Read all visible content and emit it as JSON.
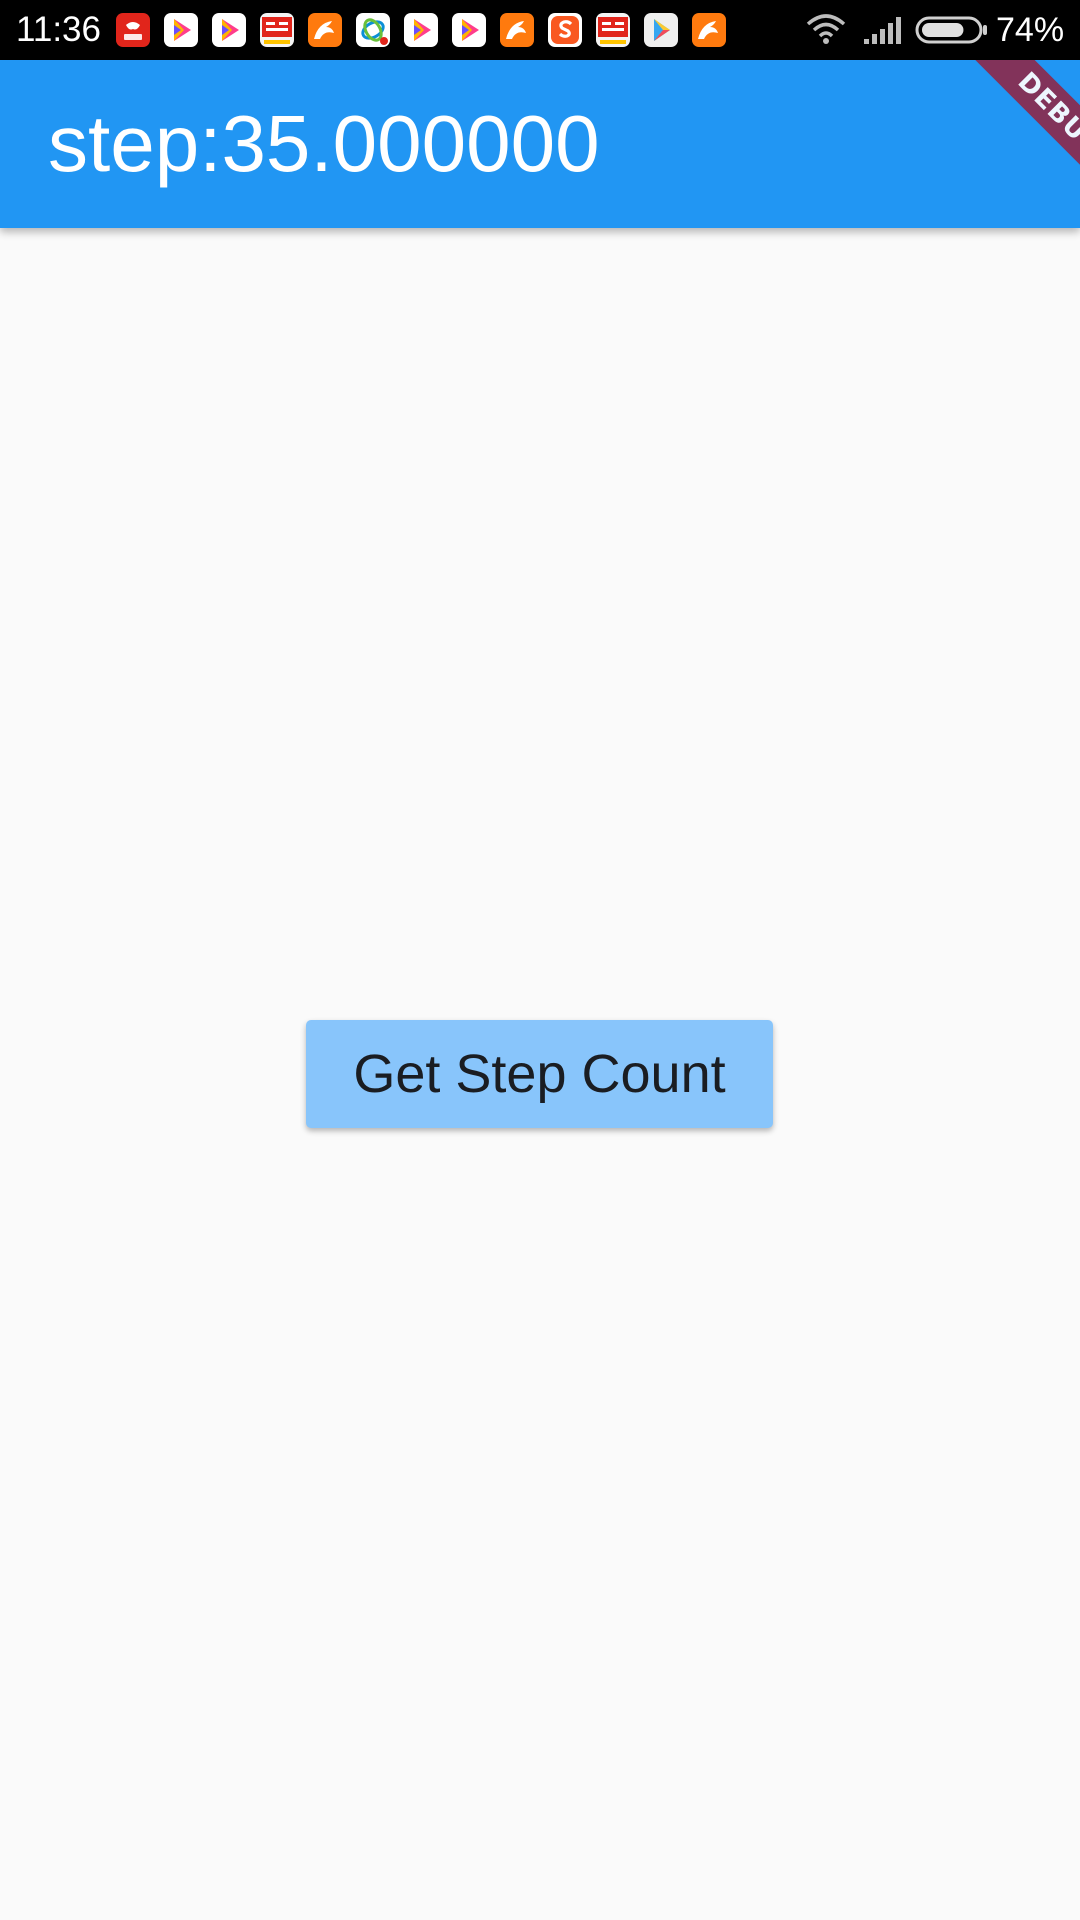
{
  "status_bar": {
    "time": "11:36",
    "battery_percent": "74%",
    "battery_level": 0.74,
    "notification_icons": [
      "jd-icon",
      "video-play-icon",
      "video-play-icon",
      "toutiao-icon",
      "uc-browser-icon",
      "china-mobile-icon",
      "video-play-icon",
      "video-play-icon",
      "uc-browser-icon",
      "sogou-icon",
      "toutiao-icon",
      "google-play-icon",
      "uc-browser-icon"
    ]
  },
  "app_bar": {
    "title": "step:35.000000",
    "color": "#2196f3"
  },
  "debug_banner": {
    "label": "DEBUG"
  },
  "main": {
    "button_label": "Get Step Count",
    "button_color": "#88c5fb"
  }
}
